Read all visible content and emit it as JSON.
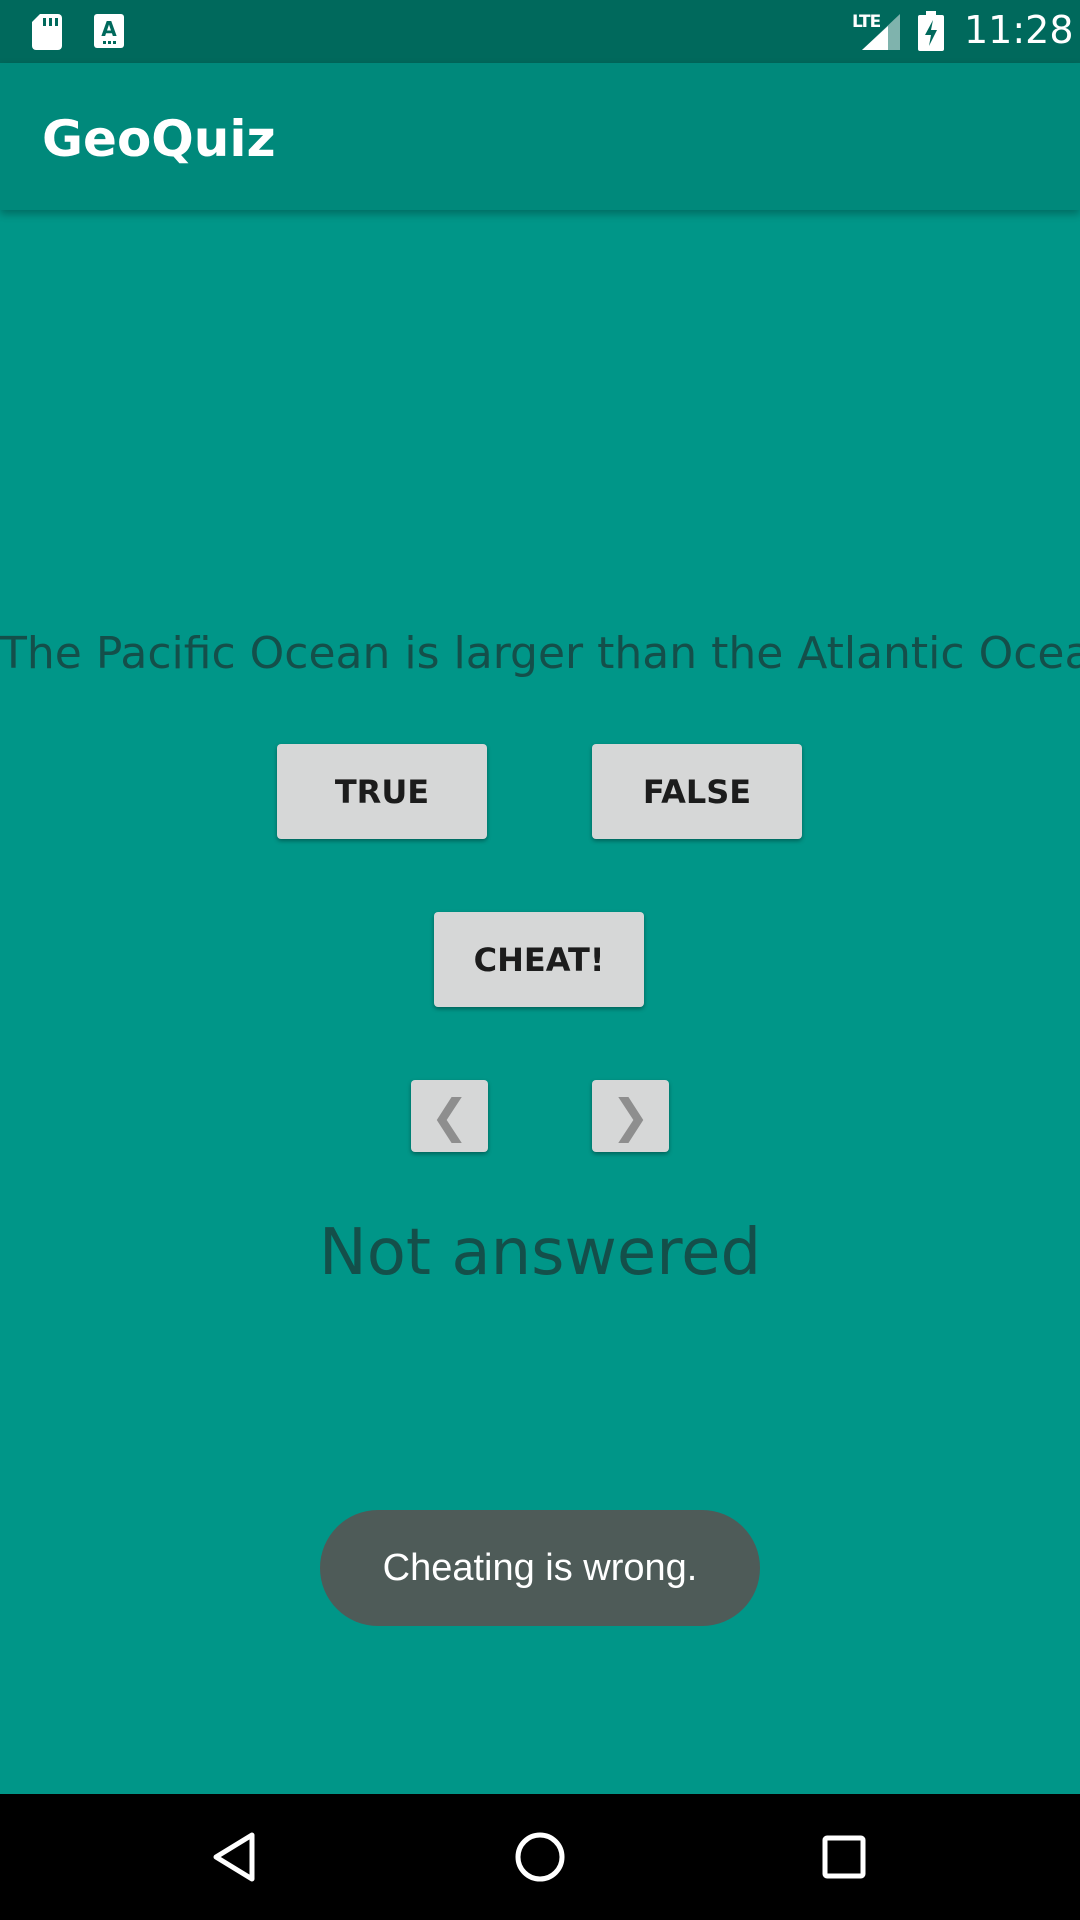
{
  "status_bar": {
    "network_label": "LTE",
    "time": "11:28",
    "icons": [
      "sd-card-icon",
      "a-notification-icon",
      "signal-icon",
      "battery-charging-icon"
    ]
  },
  "app_bar": {
    "title": "GeoQuiz"
  },
  "quiz": {
    "question": "The Pacific Ocean is larger than the Atlantic Ocean.",
    "true_label": "TRUE",
    "false_label": "FALSE",
    "cheat_label": "CHEAT!",
    "prev_label": "❮",
    "next_label": "❯",
    "status": "Not answered"
  },
  "toast": {
    "message": "Cheating is wrong."
  },
  "nav_bar": {
    "icons": [
      "back-icon",
      "home-icon",
      "recents-icon"
    ]
  },
  "colors": {
    "background": "#009688",
    "app_bar": "#00897b",
    "status_bar": "#00695c",
    "text_dark": "#144f4a",
    "button": "#d6d7d7",
    "toast": "#4e5b58"
  }
}
